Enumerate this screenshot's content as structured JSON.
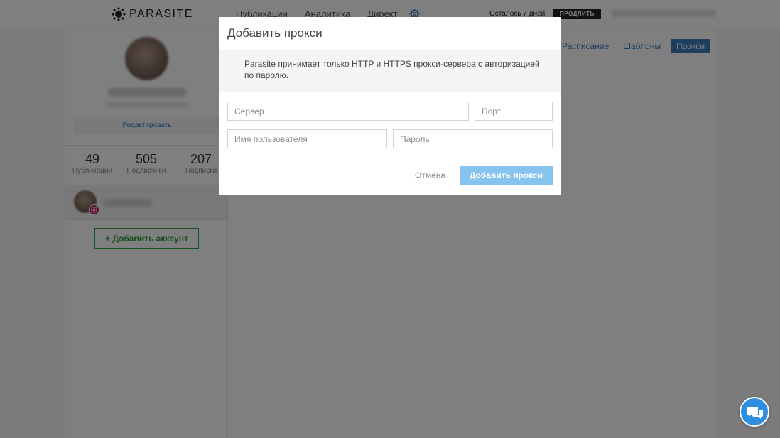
{
  "header": {
    "logo_text": "PARASITE",
    "nav": [
      "Публикации",
      "Аналитика",
      "Директ"
    ],
    "trial_text": "Осталось 7 дней",
    "extend_label": "ПРОДЛИТЬ"
  },
  "sidebar": {
    "edit_label": "Редактировать",
    "stats": [
      {
        "value": "49",
        "label": "Публикации"
      },
      {
        "value": "505",
        "label": "Подписчики"
      },
      {
        "value": "207",
        "label": "Подписки"
      }
    ],
    "add_account_label": "+ Добавить аккаунт"
  },
  "main": {
    "tabs": [
      {
        "label": "Расписание",
        "active": false
      },
      {
        "label": "Шаблоны",
        "active": false
      },
      {
        "label": "Прокси",
        "active": true
      }
    ]
  },
  "modal": {
    "title": "Добавить прокси",
    "info": "Parasite принимает только HTTP и HTTPS прокси-сервера с авторизацией по паролю.",
    "server_placeholder": "Сервер",
    "port_placeholder": "Порт",
    "username_placeholder": "Имя пользователя",
    "password_placeholder": "Пароль",
    "cancel_label": "Отмена",
    "submit_label": "Добавить прокси"
  },
  "colors": {
    "accent": "#3b7dbf",
    "submit": "#86c4ef",
    "add_account": "#2e9e3e",
    "chat": "#2e8ee0",
    "instagram_badge": "#c2185b"
  },
  "icons": {
    "logo": "parasite-logo-icon",
    "settings": "gear-icon",
    "instagram": "instagram-icon",
    "chat": "chat-bubbles-icon"
  }
}
